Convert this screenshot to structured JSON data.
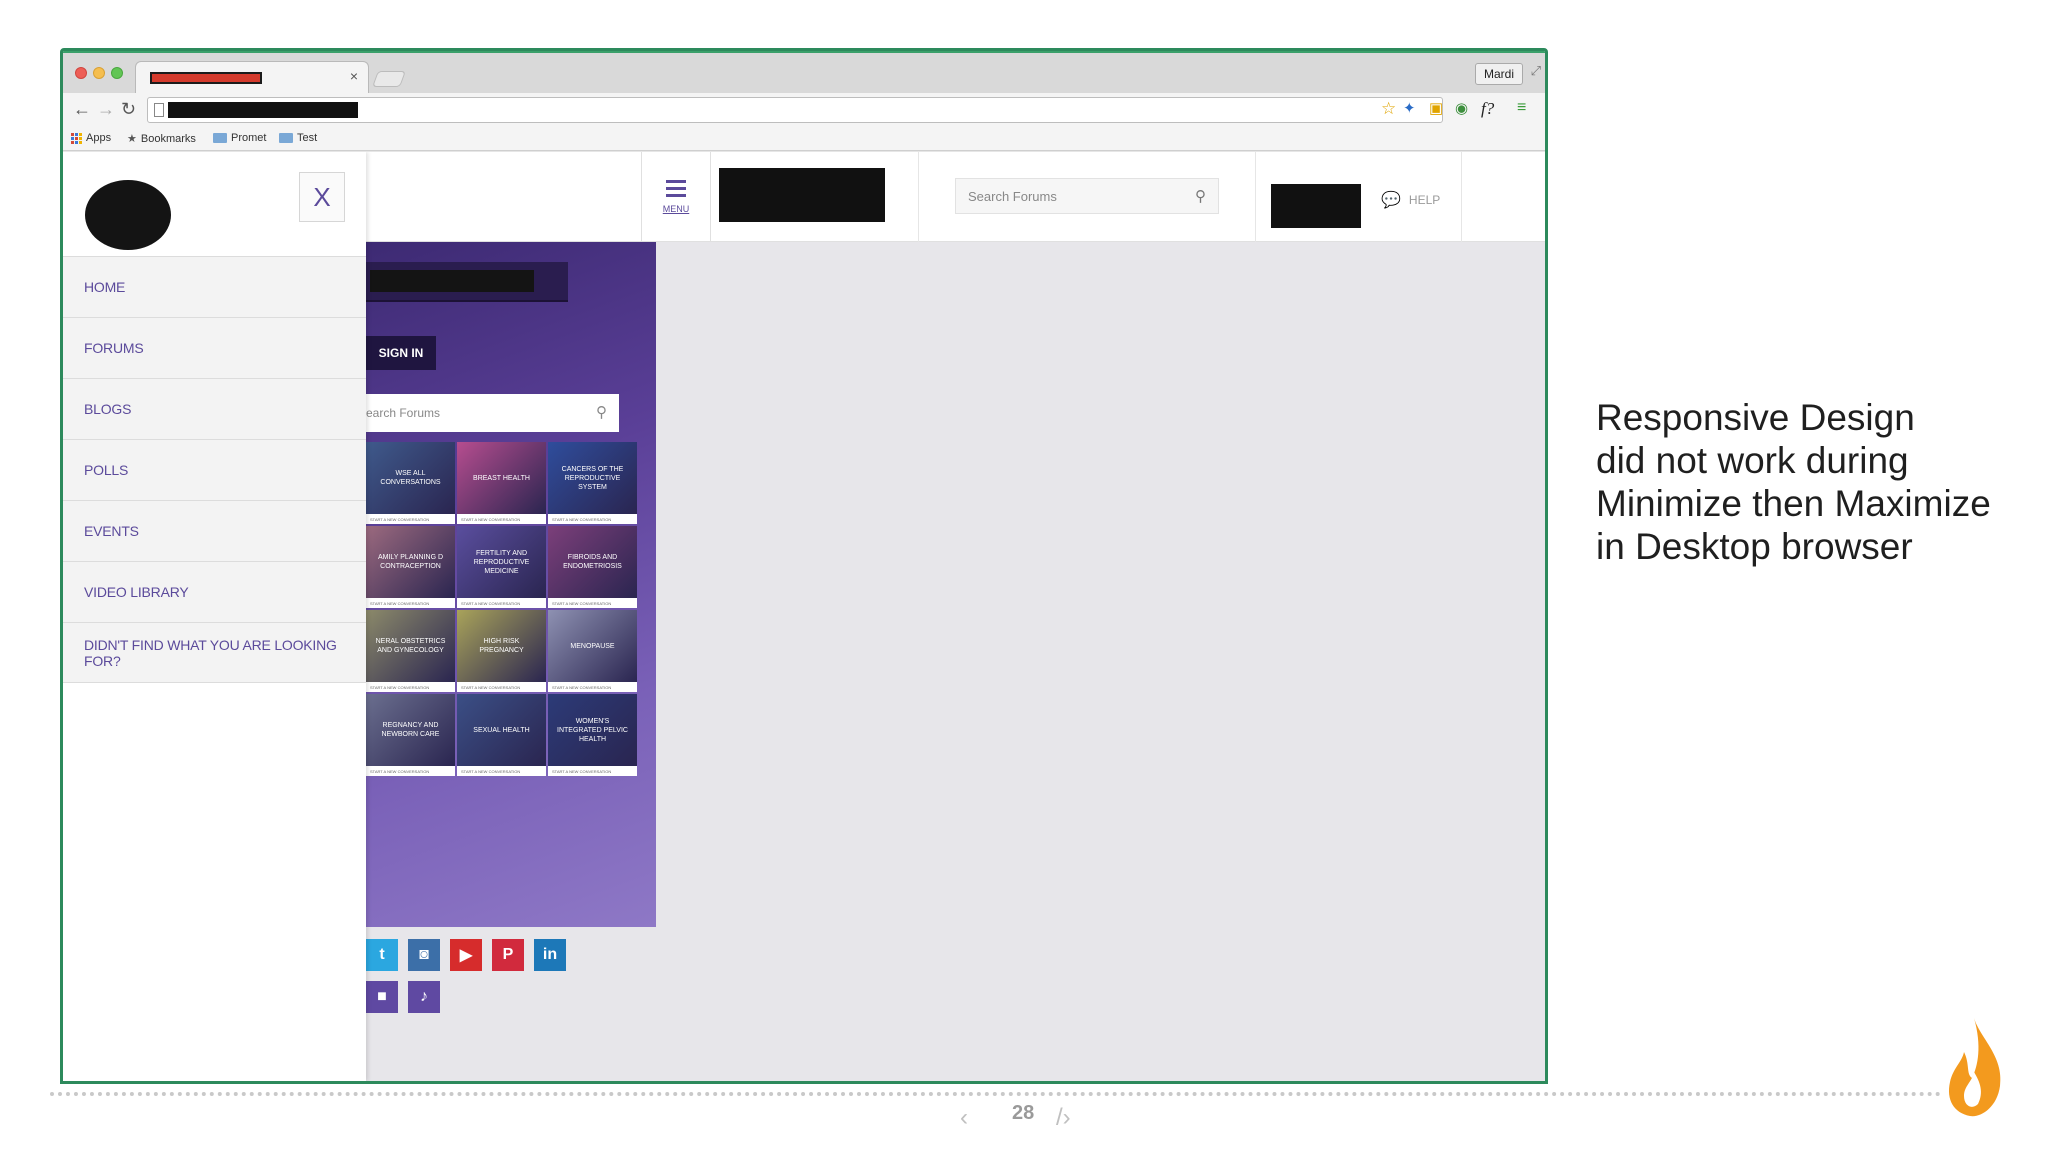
{
  "browser": {
    "tab_close": "×",
    "user_label": "Mardi",
    "bookmarks": {
      "apps": "Apps",
      "bookmarks": "Bookmarks",
      "promet": "Promet",
      "test": "Test"
    },
    "nav": {
      "back": "←",
      "forward": "→",
      "reload": "↻"
    },
    "extensions": {
      "star": "☆",
      "fx": "f?"
    }
  },
  "site": {
    "menu_label": "MENU",
    "search_placeholder": "Search Forums",
    "help_label": "HELP",
    "sidenav": {
      "close_label": "X",
      "items": [
        "HOME",
        "FORUMS",
        "BLOGS",
        "POLLS",
        "EVENTS",
        "VIDEO LIBRARY",
        "DIDN'T FIND WHAT YOU ARE LOOKING FOR?"
      ]
    },
    "hero": {
      "signin_label": "SIGN IN",
      "search_placeholder": "earch Forums",
      "tiles": [
        {
          "label": "WSE ALL CONVERSATIONS",
          "color": "#3f5a8c"
        },
        {
          "label": "BREAST HEALTH",
          "color": "#b64d8f"
        },
        {
          "label": "CANCERS OF THE REPRODUCTIVE SYSTEM",
          "color": "#2f4d9c"
        },
        {
          "label": "AMILY PLANNING D CONTRACEPTION",
          "color": "#9c6a7f"
        },
        {
          "label": "FERTILITY AND REPRODUCTIVE MEDICINE",
          "color": "#5a4e9e"
        },
        {
          "label": "FIBROIDS AND ENDOMETRIOSIS",
          "color": "#7c3f7a"
        },
        {
          "label": "NERAL OBSTETRICS AND GYNECOLOGY",
          "color": "#8c8a6a"
        },
        {
          "label": "HIGH RISK PREGNANCY",
          "color": "#a9a35a"
        },
        {
          "label": "MENOPAUSE",
          "color": "#8e91b2"
        },
        {
          "label": "REGNANCY AND NEWBORN CARE",
          "color": "#6b6f8f"
        },
        {
          "label": "SEXUAL HEALTH",
          "color": "#3b4f86"
        },
        {
          "label": "WOMEN'S INTEGRATED PELVIC HEALTH",
          "color": "#2c3b78"
        }
      ],
      "tile_footer": "START A NEW CONVERSATION"
    },
    "social": [
      {
        "name": "twitter-icon",
        "glyph": "t",
        "color": "#2ba7e0"
      },
      {
        "name": "instagram-icon",
        "glyph": "◙",
        "color": "#3c6fa8"
      },
      {
        "name": "youtube-icon",
        "glyph": "▶",
        "color": "#d62c2c"
      },
      {
        "name": "pinterest-icon",
        "glyph": "P",
        "color": "#d12a3d"
      },
      {
        "name": "linkedin-icon",
        "glyph": "in",
        "color": "#1d78b8"
      },
      {
        "name": "video-icon",
        "glyph": "■",
        "color": "#5f49a2"
      },
      {
        "name": "podcast-icon",
        "glyph": "♪",
        "color": "#5f49a2"
      }
    ]
  },
  "slide": {
    "caption_lines": [
      "Responsive Design",
      "did not work during",
      "Minimize then Maximize",
      "in Desktop browser"
    ],
    "page_number": "28",
    "pager_prev": "‹",
    "pager_next": "/›"
  },
  "colors": {
    "brand_purple": "#5b4a9b",
    "brand_orange": "#f39a1e",
    "window_frame": "#2d8a5c"
  }
}
